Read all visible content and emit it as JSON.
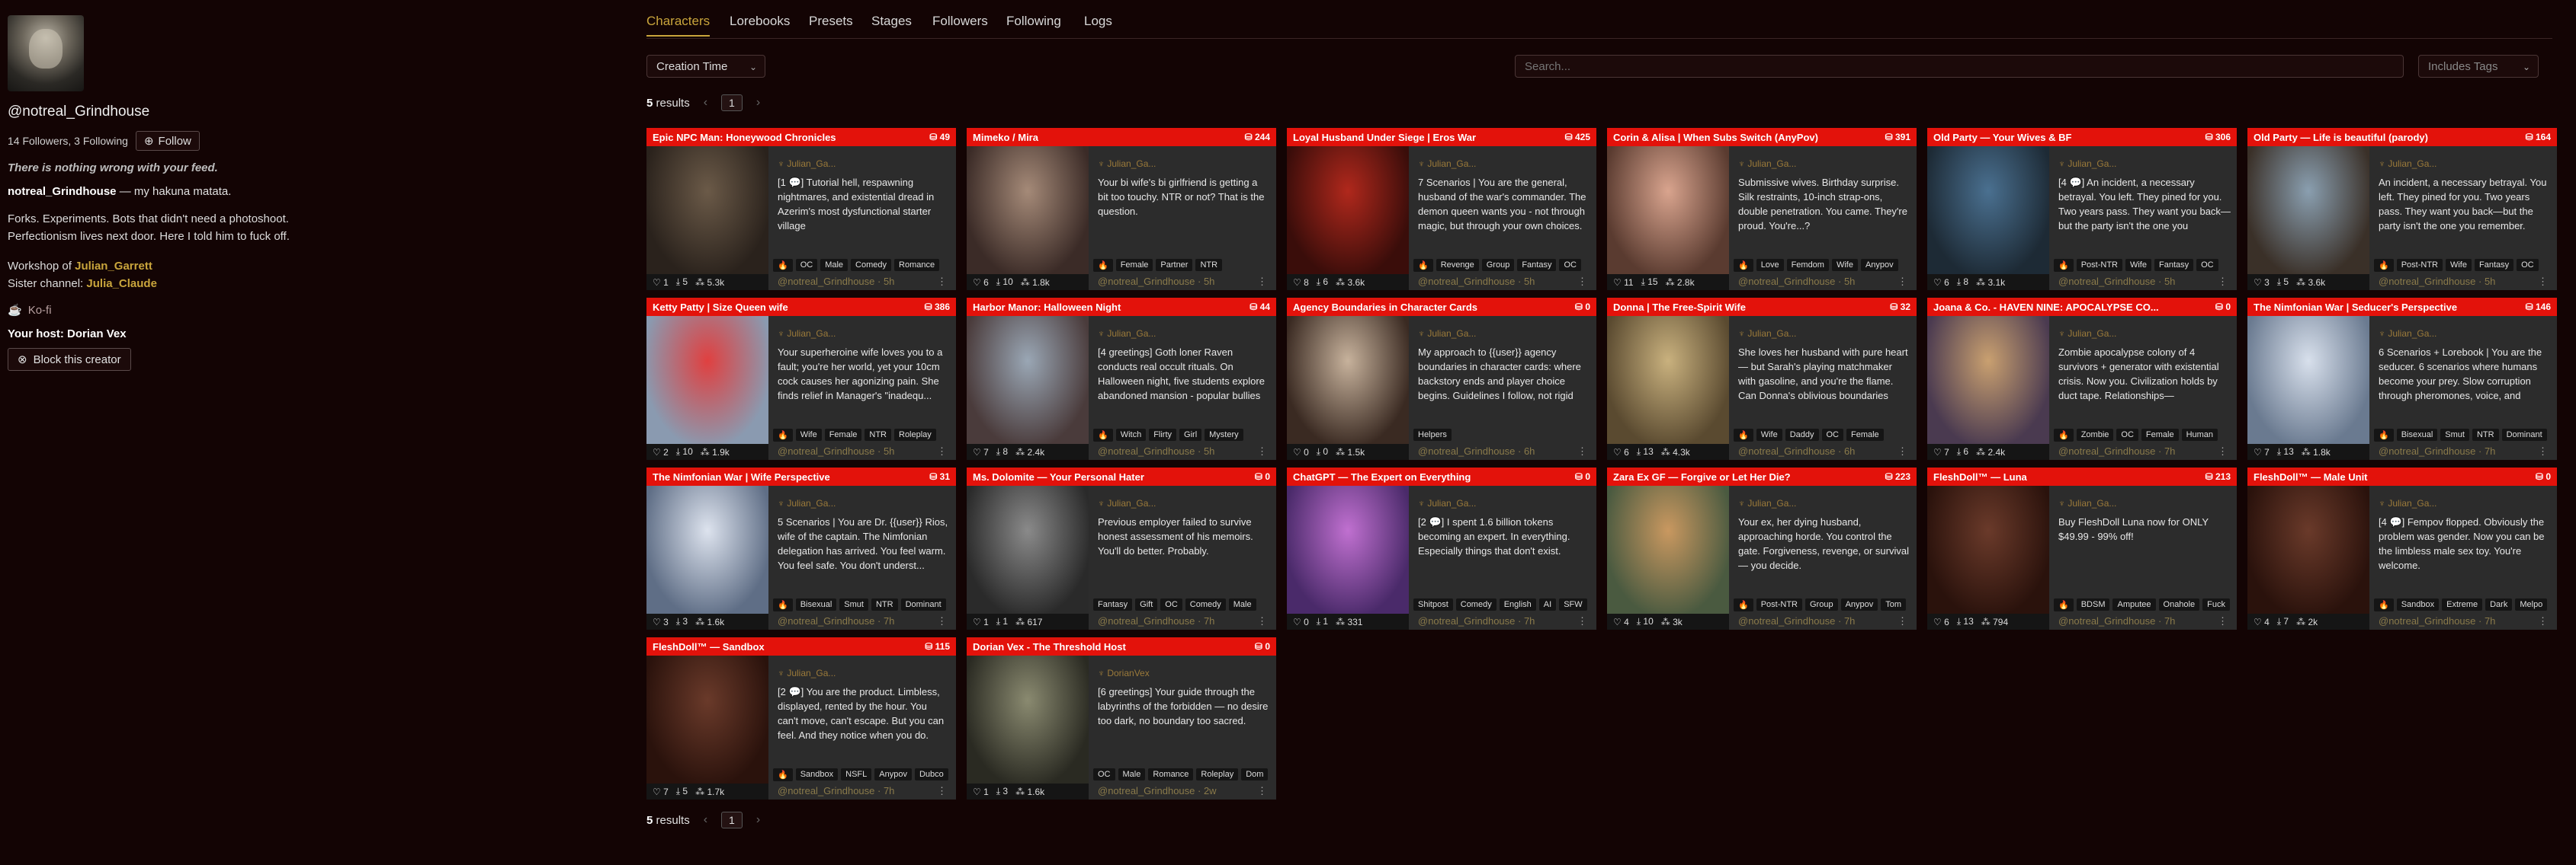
{
  "profile": {
    "handle": "@notreal_Grindhouse",
    "followers": "14 Followers, 3 Following",
    "follow_label": "Follow",
    "tagline": "There is nothing wrong with your feed.",
    "motto_name": "notreal_Grindhouse",
    "motto_text": " — my hakuna matata.",
    "bio1": "Forks. Experiments. Bots that didn't need a photoshoot.",
    "bio2": "Perfectionism lives next door. Here I told him to fuck off.",
    "workshop_label": "Workshop of ",
    "workshop_link": "Julian_Garrett",
    "sister_label": "Sister channel: ",
    "sister_link": "Julia_Claude",
    "kofi": "Ko-fi",
    "host": "Your host: Dorian Vex",
    "block_label": "Block this creator"
  },
  "tabs": [
    "Characters",
    "Lorebooks",
    "Presets",
    "Stages",
    "Followers",
    "Following",
    "Logs"
  ],
  "controls": {
    "sort": "Creation Time",
    "search_placeholder": "Search...",
    "tags_placeholder": "Includes Tags"
  },
  "results": {
    "count": "5",
    "label": " results",
    "page": "1",
    "prev": "‹",
    "next": "›"
  },
  "cards": [
    {
      "title": "Epic NPC Man: Honeywood Chronicles",
      "count": "49",
      "author": "Julian_Ga...",
      "desc": "[1 💬] Tutorial hell, respawning nightmares, and existential dread in Azerim's most dysfunctional starter village",
      "tags": [
        "🔥",
        "OC",
        "Male",
        "Comedy",
        "Romance"
      ],
      "likes": "1",
      "dl": "5",
      "views": "5.3k",
      "foot": "@notreal_Grindhouse · 5h",
      "c1": "#6b5a48",
      "c2": "#2a221c"
    },
    {
      "title": "Mimeko / Mira",
      "count": "244",
      "author": "Julian_Ga...",
      "desc": "Your bi wife's bi girlfriend is getting a bit too touchy. NTR or not? That is the question.",
      "tags": [
        "🔥",
        "Female",
        "Partner",
        "NTR"
      ],
      "likes": "6",
      "dl": "10",
      "views": "1.8k",
      "foot": "@notreal_Grindhouse · 5h",
      "c1": "#a58a78",
      "c2": "#3b2b27"
    },
    {
      "title": "Loyal Husband Under Siege | Eros War",
      "count": "425",
      "author": "Julian_Ga...",
      "desc": "7 Scenarios | You are the general, husband of the war's commander. The demon queen wants you - not through magic, but through your own choices. Wil...",
      "tags": [
        "🔥",
        "Revenge",
        "Group",
        "Fantasy",
        "OC"
      ],
      "likes": "8",
      "dl": "6",
      "views": "3.6k",
      "foot": "@notreal_Grindhouse · 5h",
      "c1": "#b0281c",
      "c2": "#3a0d0a"
    },
    {
      "title": "Corin & Alisa | When Subs Switch (AnyPov)",
      "count": "391",
      "author": "Julian_Ga...",
      "desc": "Submissive wives. Birthday surprise. Silk restraints, 10-inch strap-ons, double penetration. You came. They're proud. You're...?",
      "tags": [
        "🔥",
        "Love",
        "Femdom",
        "Wife",
        "Anypov"
      ],
      "likes": "11",
      "dl": "15",
      "views": "2.8k",
      "foot": "@notreal_Grindhouse · 5h",
      "c1": "#d9a48e",
      "c2": "#5a3b30"
    },
    {
      "title": "Old Party — Your Wives & BF",
      "count": "306",
      "author": "Julian_Ga...",
      "desc": "[4 💬] An incident, a necessary betrayal. You left. They pined for you. Two years pass. They want you back—but the party isn't the one you remember.",
      "tags": [
        "🔥",
        "Post-NTR",
        "Wife",
        "Fantasy",
        "OC"
      ],
      "likes": "6",
      "dl": "8",
      "views": "3.1k",
      "foot": "@notreal_Grindhouse · 5h",
      "c1": "#4a7090",
      "c2": "#1d2a35"
    },
    {
      "title": "Old Party — Life is beautiful (parody)",
      "count": "164",
      "author": "Julian_Ga...",
      "desc": "An incident, a necessary betrayal. You left. They pined for you. Two years pass. They want you back—but the party isn't the one you remember.",
      "tags": [
        "🔥",
        "Post-NTR",
        "Wife",
        "Fantasy",
        "OC"
      ],
      "likes": "3",
      "dl": "5",
      "views": "3.6k",
      "foot": "@notreal_Grindhouse · 5h",
      "c1": "#8a9fb0",
      "c2": "#3a3028"
    },
    {
      "title": "Ketty Patty | Size Queen wife",
      "count": "386",
      "author": "Julian_Ga...",
      "desc": "Your superheroine wife loves you to a fault; you're her world, yet your 10cm cock causes her agonizing pain. She finds relief in Manager's \"inadequ...",
      "tags": [
        "🔥",
        "Wife",
        "Female",
        "NTR",
        "Roleplay"
      ],
      "likes": "2",
      "dl": "10",
      "views": "1.9k",
      "foot": "@notreal_Grindhouse · 5h",
      "c1": "#e04040",
      "c2": "#8a9ab0"
    },
    {
      "title": "Harbor Manor: Halloween Night",
      "count": "44",
      "author": "Julian_Ga...",
      "desc": "[4 greetings] Goth loner Raven conducts real occult rituals. On Halloween night, five students explore abandoned mansion - popular bullies force he...",
      "tags": [
        "🔥",
        "Witch",
        "Flirty",
        "Girl",
        "Mystery"
      ],
      "likes": "7",
      "dl": "8",
      "views": "2.4k",
      "foot": "@notreal_Grindhouse · 5h",
      "c1": "#9aa7b5",
      "c2": "#4a3b3b"
    },
    {
      "title": "Agency Boundaries in Character Cards",
      "count": "0",
      "author": "Julian_Ga...",
      "desc": "My approach to {{user}} agency boundaries in character cards: where backstory ends and player choice begins. Guidelines I follow, not rigid rules.",
      "tags": [
        "Helpers"
      ],
      "likes": "0",
      "dl": "0",
      "views": "1.5k",
      "foot": "@notreal_Grindhouse · 6h",
      "c1": "#c7b29c",
      "c2": "#3a2a22"
    },
    {
      "title": "Donna | The Free-Spirit Wife",
      "count": "32",
      "author": "Julian_Ga...",
      "desc": "She loves her husband with pure heart — but Sarah's playing matchmaker with gasoline, and you're the flame. Can Donna's oblivious boundaries surviv...",
      "tags": [
        "🔥",
        "Wife",
        "Daddy",
        "OC",
        "Female"
      ],
      "likes": "6",
      "dl": "13",
      "views": "4.3k",
      "foot": "@notreal_Grindhouse · 6h",
      "c1": "#c9b17e",
      "c2": "#5a4a30"
    },
    {
      "title": "Joana & Co. - HAVEN NINE: APOCALYPSE CO...",
      "count": "0",
      "author": "Julian_Ga...",
      "desc": "Zombie apocalypse colony of 4 survivors + generator with existential crisis. Now you. Civilization holds by duct tape. Relationships—questionable.",
      "tags": [
        "🔥",
        "Zombie",
        "OC",
        "Female",
        "Human"
      ],
      "likes": "7",
      "dl": "6",
      "views": "2.4k",
      "foot": "@notreal_Grindhouse · 7h",
      "c1": "#c9a070",
      "c2": "#4a3a50"
    },
    {
      "title": "The Nimfonian War | Seducer's Perspective",
      "count": "146",
      "author": "Julian_Ga...",
      "desc": "6 Scenarios + Lorebook | You are the seducer. 6 scenarios where humans become your prey. Slow corruption through pheromones, voice, and emotional a...",
      "tags": [
        "🔥",
        "Bisexual",
        "Smut",
        "NTR",
        "Dominant"
      ],
      "likes": "7",
      "dl": "13",
      "views": "1.8k",
      "foot": "@notreal_Grindhouse · 7h",
      "c1": "#d8e0ec",
      "c2": "#6a7a90"
    },
    {
      "title": "The Nimfonian War | Wife Perspective",
      "count": "31",
      "author": "Julian_Ga...",
      "desc": "5 Scenarios | You are Dr. {{user}} Rios, wife of the captain. The Nimfonian delegation has arrived. You feel warm. You feel safe. You don't underst...",
      "tags": [
        "🔥",
        "Bisexual",
        "Smut",
        "NTR",
        "Dominant"
      ],
      "likes": "3",
      "dl": "3",
      "views": "1.6k",
      "foot": "@notreal_Grindhouse · 7h",
      "c1": "#dde3ee",
      "c2": "#5f6e86"
    },
    {
      "title": "Ms. Dolomite — Your Personal Hater",
      "count": "0",
      "author": "Julian_Ga...",
      "desc": "Previous employer failed to survive honest assessment of his memoirs. You'll do better. Probably.",
      "tags": [
        "Fantasy",
        "Gift",
        "OC",
        "Comedy",
        "Male"
      ],
      "likes": "1",
      "dl": "1",
      "views": "617",
      "foot": "@notreal_Grindhouse · 7h",
      "c1": "#8a8a8a",
      "c2": "#2a2a2a"
    },
    {
      "title": "ChatGPT — The Expert on Everything",
      "count": "0",
      "author": "Julian_Ga...",
      "desc": "[2 💬] I spent 1.6 billion tokens becoming an expert. In everything. Especially things that don't exist.",
      "tags": [
        "Shitpost",
        "Comedy",
        "English",
        "AI",
        "SFW"
      ],
      "likes": "0",
      "dl": "1",
      "views": "331",
      "foot": "@notreal_Grindhouse · 7h",
      "c1": "#c070d0",
      "c2": "#4a2a6a"
    },
    {
      "title": "Zara Ex GF — Forgive or Let Her Die?",
      "count": "223",
      "author": "Julian_Ga...",
      "desc": "Your ex, her dying husband, approaching horde. You control the gate. Forgiveness, revenge, or survival — you decide.",
      "tags": [
        "🔥",
        "Post-NTR",
        "Group",
        "Anypov",
        "Tom"
      ],
      "likes": "4",
      "dl": "10",
      "views": "3k",
      "foot": "@notreal_Grindhouse · 7h",
      "c1": "#c99860",
      "c2": "#4a5a40"
    },
    {
      "title": "FleshDoll™ — Luna",
      "count": "213",
      "author": "Julian_Ga...",
      "desc": "Buy FleshDoll Luna now for ONLY $49.99 - 99% off!",
      "tags": [
        "🔥",
        "BDSM",
        "Amputee",
        "Onahole",
        "Fuck"
      ],
      "likes": "6",
      "dl": "13",
      "views": "794",
      "foot": "@notreal_Grindhouse · 7h",
      "c1": "#6a3a2a",
      "c2": "#2a120c"
    },
    {
      "title": "FleshDoll™ — Male Unit",
      "count": "0",
      "author": "Julian_Ga...",
      "desc": "[4 💬] Fempov flopped. Obviously the problem was gender. Now you can be the limbless male sex toy. You're welcome.",
      "tags": [
        "🔥",
        "Sandbox",
        "Extreme",
        "Dark",
        "Melpo"
      ],
      "likes": "4",
      "dl": "7",
      "views": "2k",
      "foot": "@notreal_Grindhouse · 7h",
      "c1": "#6a3a2a",
      "c2": "#2a120c"
    },
    {
      "title": "FleshDoll™ — Sandbox",
      "count": "115",
      "author": "Julian_Ga...",
      "desc": "[2 💬] You are the product. Limbless, displayed, rented by the hour. You can't move, can't escape. But you can feel. And they notice when you do.",
      "tags": [
        "🔥",
        "Sandbox",
        "NSFL",
        "Anypov",
        "Dubco"
      ],
      "likes": "7",
      "dl": "5",
      "views": "1.7k",
      "foot": "@notreal_Grindhouse · 7h",
      "c1": "#6a3a2a",
      "c2": "#2a120c"
    },
    {
      "title": "Dorian Vex - The Threshold Host",
      "count": "0",
      "author": "DorianVex",
      "desc": "[6 greetings] Your guide through the labyrinths of the forbidden — no desire too dark, no boundary too sacred.",
      "tags": [
        "OC",
        "Male",
        "Romance",
        "Roleplay",
        "Dom"
      ],
      "likes": "1",
      "dl": "3",
      "views": "1.6k",
      "foot": "@notreal_Grindhouse · 2w",
      "c1": "#8a8a70",
      "c2": "#2a2a22"
    }
  ]
}
